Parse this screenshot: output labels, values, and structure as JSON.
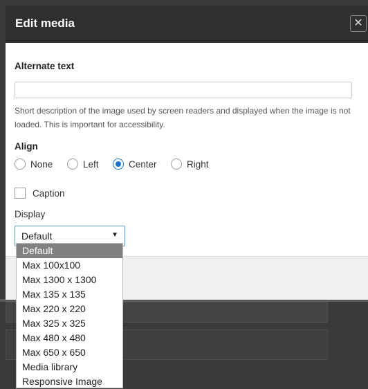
{
  "dialog": {
    "title": "Edit media",
    "close_symbol": "✕"
  },
  "alt_text": {
    "label": "Alternate text",
    "value": "",
    "description": "Short description of the image used by screen readers and displayed when the image is not loaded. This is important for accessibility."
  },
  "align": {
    "label": "Align",
    "options": [
      "None",
      "Left",
      "Center",
      "Right"
    ],
    "selected": "Center"
  },
  "caption": {
    "label": "Caption",
    "checked": false
  },
  "display": {
    "label": "Display",
    "selected": "Default",
    "options": [
      "Default",
      "Max 100x100",
      "Max 1300 x 1300",
      "Max 135 x 135",
      "Max 220 x 220",
      "Max 325 x 325",
      "Max 480 x 480",
      "Max 650 x 650",
      "Media library",
      "Responsive Image"
    ]
  },
  "colors": {
    "titlebar": "#2f2f2f",
    "accent": "#1a73c7",
    "overlay": "#3a3a3a",
    "selected_option": "#808080"
  }
}
